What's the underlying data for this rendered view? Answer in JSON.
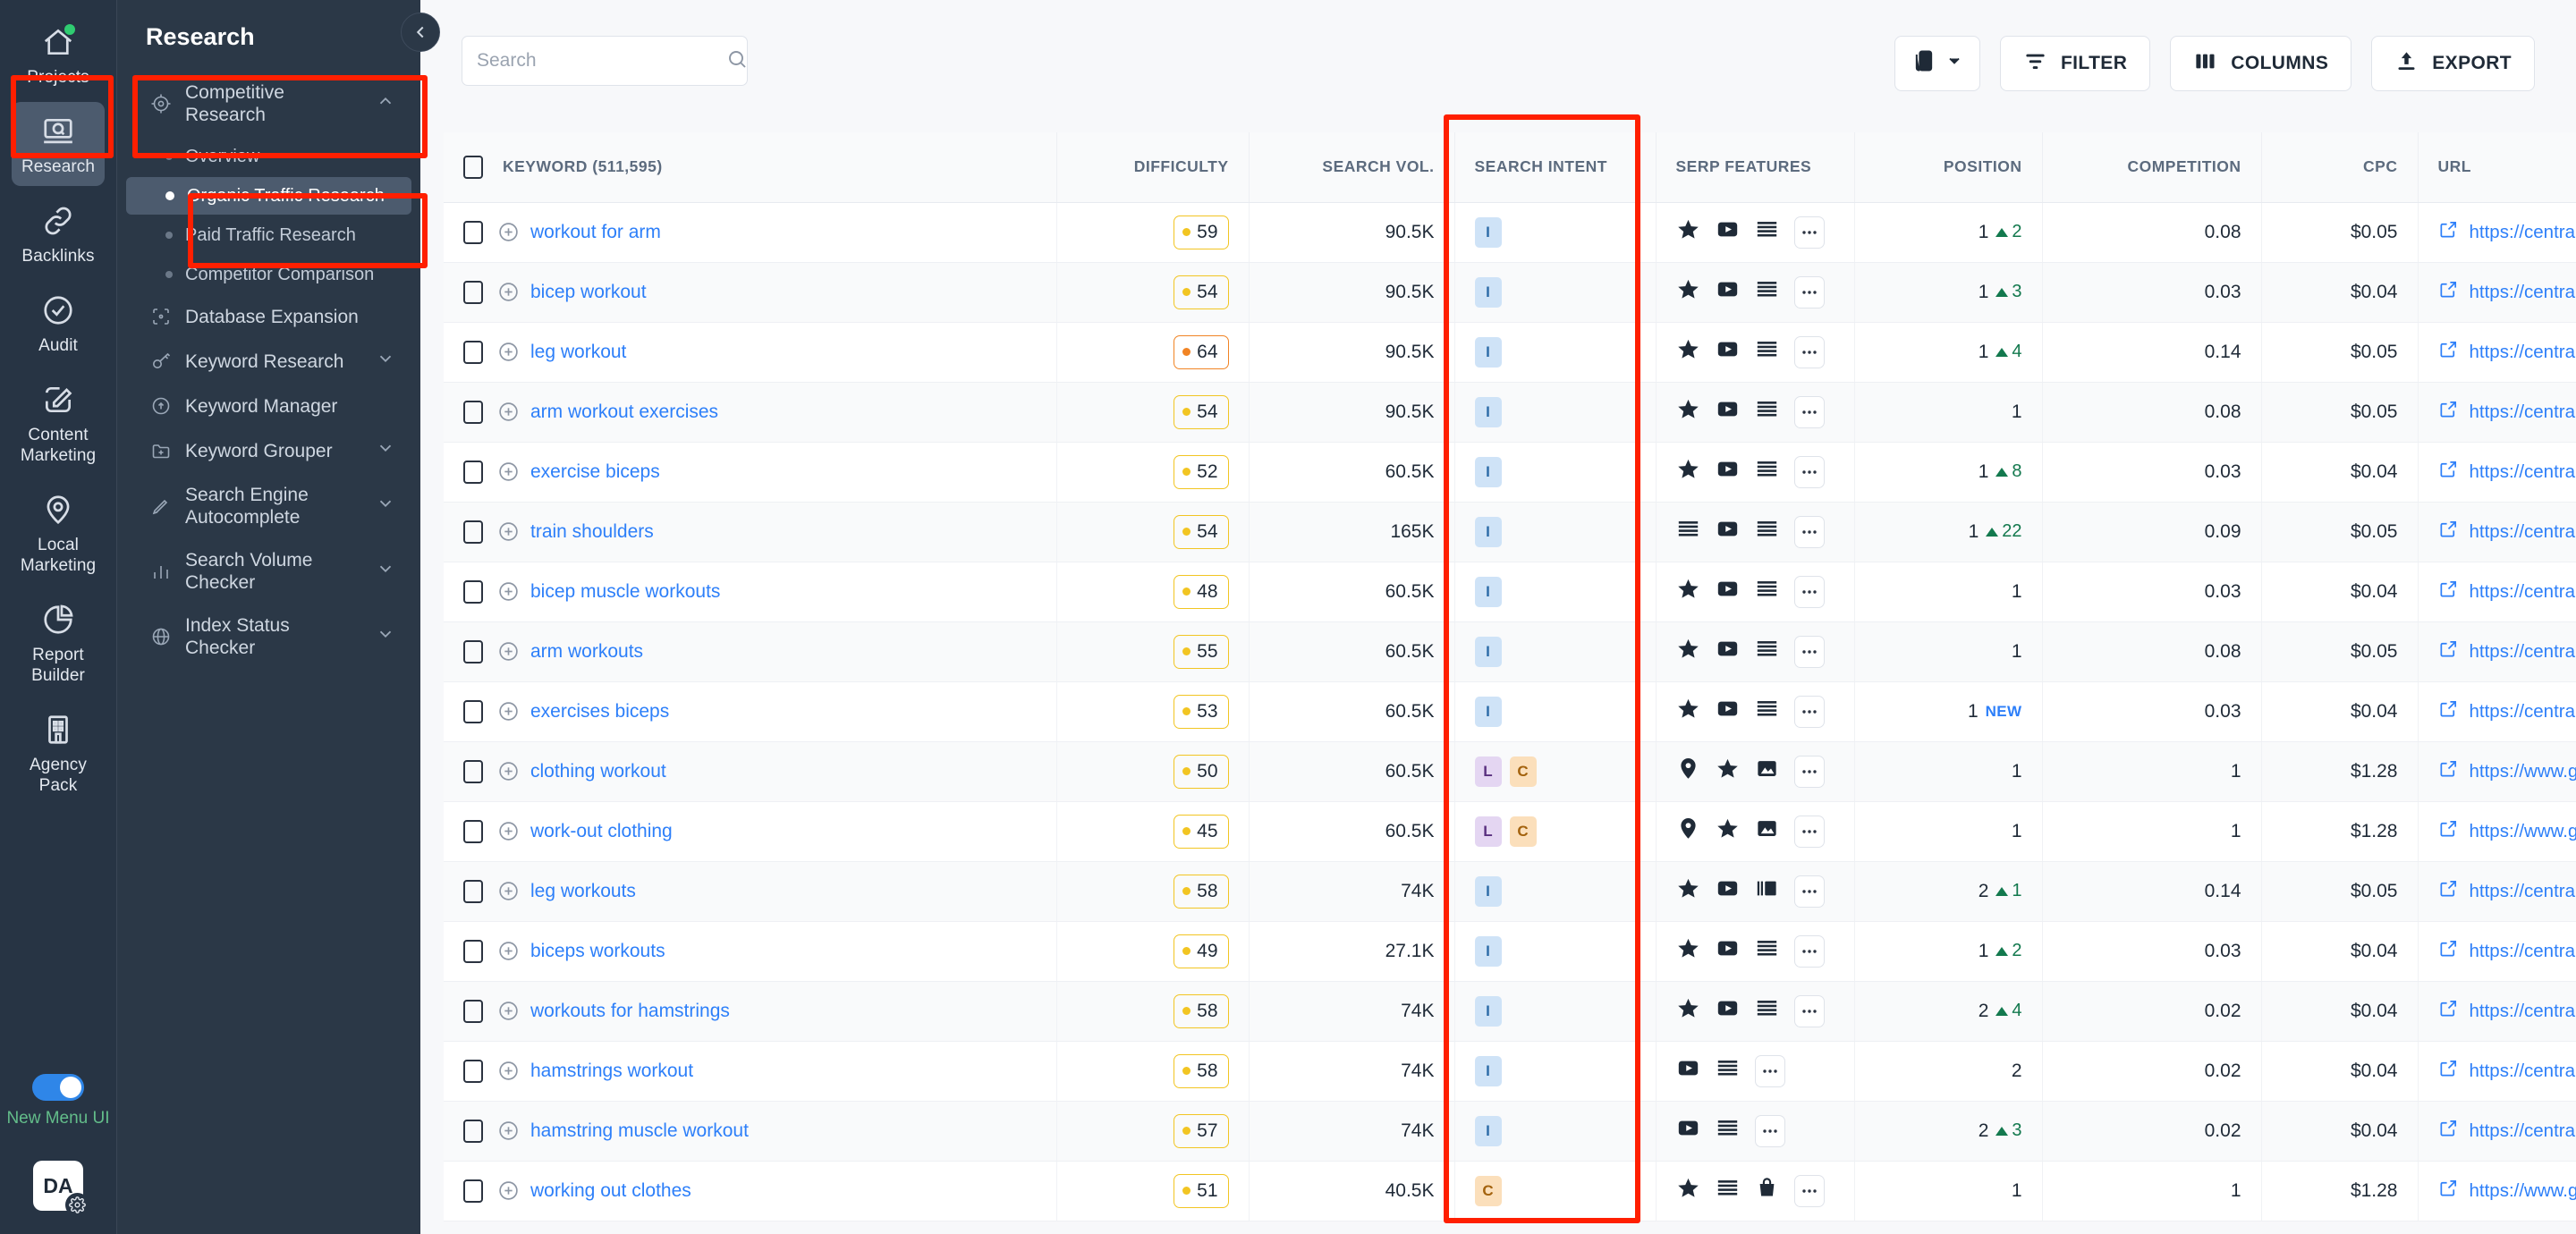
{
  "rail": {
    "items": [
      {
        "label": "Projects",
        "icon": "home-icon",
        "active": false,
        "badge": true
      },
      {
        "label": "Research",
        "icon": "research-icon",
        "active": true,
        "badge": false
      },
      {
        "label": "Backlinks",
        "icon": "link-icon",
        "active": false,
        "badge": false
      },
      {
        "label": "Audit",
        "icon": "check-circle-icon",
        "active": false,
        "badge": false
      },
      {
        "label": "Content Marketing",
        "icon": "edit-square-icon",
        "active": false,
        "badge": false
      },
      {
        "label": "Local Marketing",
        "icon": "map-pin-icon",
        "active": false,
        "badge": false
      },
      {
        "label": "Report Builder",
        "icon": "pie-chart-icon",
        "active": false,
        "badge": false
      },
      {
        "label": "Agency Pack",
        "icon": "building-icon",
        "active": false,
        "badge": false
      }
    ],
    "toggle_label": "New Menu UI",
    "toggle_on": true,
    "avatar_initials": "DA"
  },
  "subnav": {
    "title": "Research",
    "items": [
      {
        "label": "Competitive Research",
        "type": "group",
        "icon": "target-icon",
        "expanded": true,
        "highlighted": true
      },
      {
        "label": "Overview",
        "type": "sub",
        "selected": false
      },
      {
        "label": "Organic Traffic Research",
        "type": "sub",
        "selected": true,
        "highlighted": true
      },
      {
        "label": "Paid Traffic Research",
        "type": "sub",
        "selected": false
      },
      {
        "label": "Competitor Comparison",
        "type": "sub",
        "selected": false
      },
      {
        "label": "Database Expansion",
        "type": "item",
        "icon": "expand-icon"
      },
      {
        "label": "Keyword Research",
        "type": "group",
        "icon": "key-icon",
        "expanded": false
      },
      {
        "label": "Keyword Manager",
        "type": "item",
        "icon": "keyword-manager-icon"
      },
      {
        "label": "Keyword Grouper",
        "type": "group",
        "icon": "folder-plus-icon",
        "expanded": false
      },
      {
        "label": "Search Engine Autocomplete",
        "type": "group",
        "icon": "pen-icon",
        "expanded": false
      },
      {
        "label": "Search Volume Checker",
        "type": "group",
        "icon": "bar-chart-icon",
        "expanded": false
      },
      {
        "label": "Index Status Checker",
        "type": "group",
        "icon": "globe-icon",
        "expanded": false
      }
    ]
  },
  "search": {
    "placeholder": "Search",
    "value": ""
  },
  "toolbar": {
    "device_label": "",
    "filter_label": "FILTER",
    "columns_label": "COLUMNS",
    "export_label": "EXPORT"
  },
  "table": {
    "headers": [
      "KEYWORD  (511,595)",
      "DIFFICULTY",
      "SEARCH VOL.",
      "SEARCH INTENT",
      "SERP FEATURES",
      "POSITION",
      "COMPETITION",
      "CPC",
      "URL"
    ],
    "keyword_count": "511,595",
    "rows": [
      {
        "keyword": "workout for arm",
        "difficulty": "59",
        "kd_color": "yellow",
        "volume": "90.5K",
        "intent": [
          "I"
        ],
        "serp": [
          "star",
          "video",
          "snippet"
        ],
        "position": "1",
        "delta": "2",
        "new": false,
        "competition": "0.08",
        "cpc": "$0.05",
        "url": "https://central.gyms"
      },
      {
        "keyword": "bicep workout",
        "difficulty": "54",
        "kd_color": "yellow",
        "volume": "90.5K",
        "intent": [
          "I"
        ],
        "serp": [
          "star",
          "video",
          "snippet"
        ],
        "position": "1",
        "delta": "3",
        "new": false,
        "competition": "0.03",
        "cpc": "$0.04",
        "url": "https://central.gyms"
      },
      {
        "keyword": "leg workout",
        "difficulty": "64",
        "kd_color": "orange",
        "volume": "90.5K",
        "intent": [
          "I"
        ],
        "serp": [
          "star",
          "video",
          "snippet"
        ],
        "position": "1",
        "delta": "4",
        "new": false,
        "competition": "0.14",
        "cpc": "$0.05",
        "url": "https://central.gyms"
      },
      {
        "keyword": "arm workout exercises",
        "difficulty": "54",
        "kd_color": "yellow",
        "volume": "90.5K",
        "intent": [
          "I"
        ],
        "serp": [
          "star",
          "video",
          "snippet"
        ],
        "position": "1",
        "delta": "",
        "new": false,
        "competition": "0.08",
        "cpc": "$0.05",
        "url": "https://central.gyms"
      },
      {
        "keyword": "exercise biceps",
        "difficulty": "52",
        "kd_color": "yellow",
        "volume": "60.5K",
        "intent": [
          "I"
        ],
        "serp": [
          "star",
          "video",
          "snippet"
        ],
        "position": "1",
        "delta": "8",
        "new": false,
        "competition": "0.03",
        "cpc": "$0.04",
        "url": "https://central.gyms"
      },
      {
        "keyword": "train shoulders",
        "difficulty": "54",
        "kd_color": "yellow",
        "volume": "165K",
        "intent": [
          "I"
        ],
        "serp": [
          "lines",
          "video",
          "snippet"
        ],
        "position": "1",
        "delta": "22",
        "new": false,
        "competition": "0.09",
        "cpc": "$0.05",
        "url": "https://central.gyms"
      },
      {
        "keyword": "bicep muscle workouts",
        "difficulty": "48",
        "kd_color": "yellow",
        "volume": "60.5K",
        "intent": [
          "I"
        ],
        "serp": [
          "star",
          "video",
          "snippet"
        ],
        "position": "1",
        "delta": "",
        "new": false,
        "competition": "0.03",
        "cpc": "$0.04",
        "url": "https://central.gyms"
      },
      {
        "keyword": "arm workouts",
        "difficulty": "55",
        "kd_color": "yellow",
        "volume": "60.5K",
        "intent": [
          "I"
        ],
        "serp": [
          "star",
          "video",
          "snippet"
        ],
        "position": "1",
        "delta": "",
        "new": false,
        "competition": "0.08",
        "cpc": "$0.05",
        "url": "https://central.gyms"
      },
      {
        "keyword": "exercises biceps",
        "difficulty": "53",
        "kd_color": "yellow",
        "volume": "60.5K",
        "intent": [
          "I"
        ],
        "serp": [
          "star",
          "video",
          "snippet"
        ],
        "position": "1",
        "delta": "",
        "new": true,
        "competition": "0.03",
        "cpc": "$0.04",
        "url": "https://central.gyms"
      },
      {
        "keyword": "clothing workout",
        "difficulty": "50",
        "kd_color": "yellow",
        "volume": "60.5K",
        "intent": [
          "L",
          "C"
        ],
        "serp": [
          "pin",
          "star",
          "image"
        ],
        "position": "1",
        "delta": "",
        "new": false,
        "competition": "1",
        "cpc": "$1.28",
        "url": "https://www.gymsh"
      },
      {
        "keyword": "work-out clothing",
        "difficulty": "45",
        "kd_color": "yellow",
        "volume": "60.5K",
        "intent": [
          "L",
          "C"
        ],
        "serp": [
          "pin",
          "star",
          "image"
        ],
        "position": "1",
        "delta": "",
        "new": false,
        "competition": "1",
        "cpc": "$1.28",
        "url": "https://www.gymsh"
      },
      {
        "keyword": "leg workouts",
        "difficulty": "58",
        "kd_color": "yellow",
        "volume": "74K",
        "intent": [
          "I"
        ],
        "serp": [
          "star",
          "video",
          "carousel"
        ],
        "position": "2",
        "delta": "1",
        "new": false,
        "competition": "0.14",
        "cpc": "$0.05",
        "url": "https://central.gyms"
      },
      {
        "keyword": "biceps workouts",
        "difficulty": "49",
        "kd_color": "yellow",
        "volume": "27.1K",
        "intent": [
          "I"
        ],
        "serp": [
          "star",
          "video",
          "snippet"
        ],
        "position": "1",
        "delta": "2",
        "new": false,
        "competition": "0.03",
        "cpc": "$0.04",
        "url": "https://central.gyms"
      },
      {
        "keyword": "workouts for hamstrings",
        "difficulty": "58",
        "kd_color": "yellow",
        "volume": "74K",
        "intent": [
          "I"
        ],
        "serp": [
          "star",
          "video",
          "snippet"
        ],
        "position": "2",
        "delta": "4",
        "new": false,
        "competition": "0.02",
        "cpc": "$0.04",
        "url": "https://central.gyms"
      },
      {
        "keyword": "hamstrings workout",
        "difficulty": "58",
        "kd_color": "yellow",
        "volume": "74K",
        "intent": [
          "I"
        ],
        "serp": [
          "video",
          "snippet"
        ],
        "position": "2",
        "delta": "",
        "new": false,
        "competition": "0.02",
        "cpc": "$0.04",
        "url": "https://central.gyms"
      },
      {
        "keyword": "hamstring muscle workout",
        "difficulty": "57",
        "kd_color": "yellow",
        "volume": "74K",
        "intent": [
          "I"
        ],
        "serp": [
          "video",
          "snippet"
        ],
        "position": "2",
        "delta": "3",
        "new": false,
        "competition": "0.02",
        "cpc": "$0.04",
        "url": "https://central.gyms"
      },
      {
        "keyword": "working out clothes",
        "difficulty": "51",
        "kd_color": "yellow",
        "volume": "40.5K",
        "intent": [
          "C"
        ],
        "serp": [
          "star",
          "snippet",
          "shop"
        ],
        "position": "1",
        "delta": "",
        "new": false,
        "competition": "1",
        "cpc": "$1.28",
        "url": "https://www.gymsh"
      }
    ]
  }
}
